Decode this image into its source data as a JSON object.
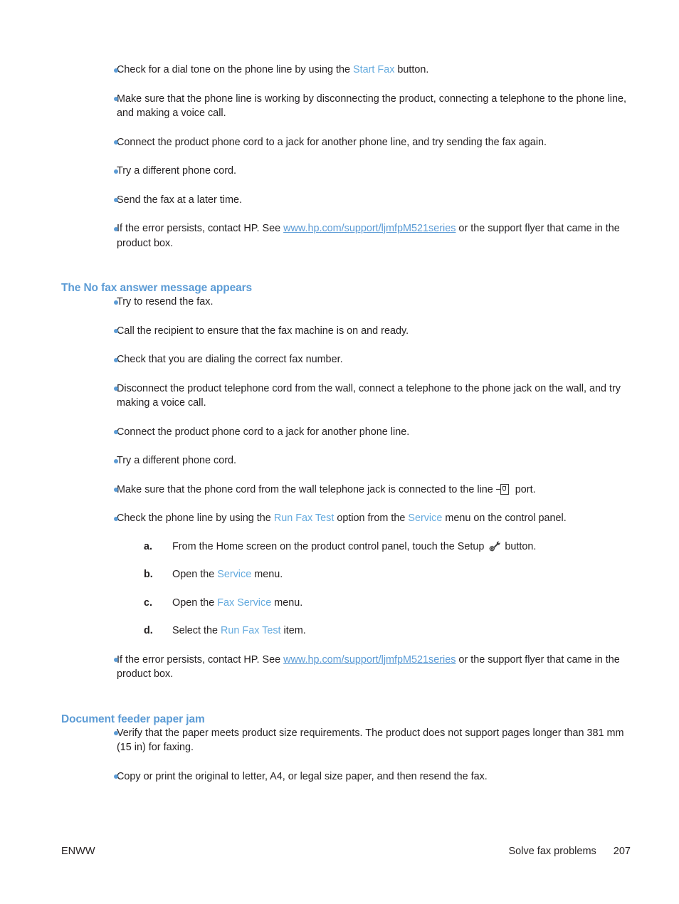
{
  "page": {
    "colors": {
      "heading_blue": "#5b9bd5",
      "ui_term_blue": "#64aade",
      "link_blue": "#5b9bd5",
      "bullet_blue": "#5b9bd5",
      "body_text": "#231f20"
    }
  },
  "top_list": {
    "items": [
      {
        "parts": [
          {
            "t": "text",
            "v": "Check for a dial tone on the phone line by using the "
          },
          {
            "t": "ui",
            "v": "Start Fax"
          },
          {
            "t": "text",
            "v": " button."
          }
        ]
      },
      {
        "parts": [
          {
            "t": "text",
            "v": "Make sure that the phone line is working by disconnecting the product, connecting a telephone to the phone line, and making a voice call."
          }
        ]
      },
      {
        "parts": [
          {
            "t": "text",
            "v": "Connect the product phone cord to a jack for another phone line, and try sending the fax again."
          }
        ]
      },
      {
        "parts": [
          {
            "t": "text",
            "v": "Try a different phone cord."
          }
        ]
      },
      {
        "parts": [
          {
            "t": "text",
            "v": "Send the fax at a later time."
          }
        ]
      },
      {
        "parts": [
          {
            "t": "text",
            "v": "If the error persists, contact HP. See "
          },
          {
            "t": "link",
            "v": "www.hp.com/support/ljmfpM521series"
          },
          {
            "t": "text",
            "v": " or the support flyer that came in the product box."
          }
        ]
      }
    ]
  },
  "section_no_fax_answer": {
    "heading": "The No fax answer message appears",
    "items": [
      {
        "parts": [
          {
            "t": "text",
            "v": "Try to resend the fax."
          }
        ]
      },
      {
        "parts": [
          {
            "t": "text",
            "v": "Call the recipient to ensure that the fax machine is on and ready."
          }
        ]
      },
      {
        "parts": [
          {
            "t": "text",
            "v": "Check that you are dialing the correct fax number."
          }
        ]
      },
      {
        "parts": [
          {
            "t": "text",
            "v": "Disconnect the product telephone cord from the wall, connect a telephone to the phone jack on the wall, and try making a voice call."
          }
        ]
      },
      {
        "parts": [
          {
            "t": "text",
            "v": "Connect the product phone cord to a jack for another phone line."
          }
        ]
      },
      {
        "parts": [
          {
            "t": "text",
            "v": "Try a different phone cord."
          }
        ]
      },
      {
        "parts": [
          {
            "t": "text",
            "v": "Make sure that the phone cord from the wall telephone jack is connected to the line "
          },
          {
            "t": "icon",
            "v": "phone-line-port-icon"
          },
          {
            "t": "text",
            "v": " port."
          }
        ]
      },
      {
        "parts": [
          {
            "t": "text",
            "v": "Check the phone line by using the "
          },
          {
            "t": "ui",
            "v": "Run Fax Test"
          },
          {
            "t": "text",
            "v": " option from the "
          },
          {
            "t": "ui",
            "v": "Service"
          },
          {
            "t": "text",
            "v": " menu on the control panel."
          }
        ],
        "substeps": [
          {
            "marker": "a.",
            "parts": [
              {
                "t": "text",
                "v": "From the Home screen on the product control panel, touch the Setup "
              },
              {
                "t": "icon",
                "v": "setup-wrench-gear-icon"
              },
              {
                "t": "text",
                "v": " button."
              }
            ]
          },
          {
            "marker": "b.",
            "parts": [
              {
                "t": "text",
                "v": "Open the "
              },
              {
                "t": "ui",
                "v": "Service"
              },
              {
                "t": "text",
                "v": " menu."
              }
            ]
          },
          {
            "marker": "c.",
            "parts": [
              {
                "t": "text",
                "v": "Open the "
              },
              {
                "t": "ui",
                "v": "Fax Service"
              },
              {
                "t": "text",
                "v": " menu."
              }
            ]
          },
          {
            "marker": "d.",
            "parts": [
              {
                "t": "text",
                "v": "Select the "
              },
              {
                "t": "ui",
                "v": "Run Fax Test"
              },
              {
                "t": "text",
                "v": " item."
              }
            ]
          }
        ]
      },
      {
        "parts": [
          {
            "t": "text",
            "v": "If the error persists, contact HP. See "
          },
          {
            "t": "link",
            "v": "www.hp.com/support/ljmfpM521series"
          },
          {
            "t": "text",
            "v": " or the support flyer that came in the product box."
          }
        ]
      }
    ]
  },
  "section_doc_feeder_jam": {
    "heading": "Document feeder paper jam",
    "items": [
      {
        "parts": [
          {
            "t": "text",
            "v": "Verify that the paper meets product size requirements. The product does not support pages longer than 381 mm (15 in) for faxing."
          }
        ]
      },
      {
        "parts": [
          {
            "t": "text",
            "v": "Copy or print the original to letter, A4, or legal size paper, and then resend the fax."
          }
        ]
      }
    ]
  },
  "footer": {
    "left": "ENWW",
    "chapter": "Solve fax problems",
    "page_number": "207"
  }
}
